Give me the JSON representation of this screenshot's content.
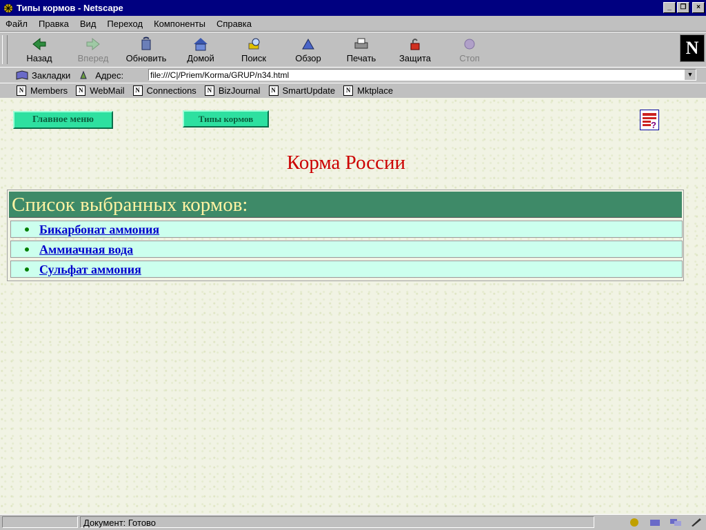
{
  "window": {
    "title": "Типы кормов - Netscape",
    "minimize": "_",
    "maximize": "❐",
    "close": "×"
  },
  "menu": [
    "Файл",
    "Правка",
    "Вид",
    "Переход",
    "Компоненты",
    "Справка"
  ],
  "toolbar": {
    "back": "Назад",
    "forward": "Вперед",
    "reload": "Обновить",
    "home": "Домой",
    "search": "Поиск",
    "guide": "Обзор",
    "print": "Печать",
    "security": "Защита",
    "stop": "Стоп"
  },
  "logo": "N",
  "location": {
    "bookmarks": "Закладки",
    "address_label": "Адрес:",
    "url": "file:///C|/Priem/Korma/GRUP/n34.html"
  },
  "personal": [
    "Members",
    "WebMail",
    "Connections",
    "BizJournal",
    "SmartUpdate",
    "Mktplace"
  ],
  "page": {
    "main_menu": "Главное меню",
    "feed_types": "Типы кормов",
    "title": "Корма России",
    "list_header": "Список выбранных кормов:",
    "items": [
      "Бикарбонат аммония",
      "Аммиачная вода",
      "Сульфат аммония"
    ]
  },
  "status": {
    "text": "Документ: Готово"
  },
  "colors": {
    "titlebar": "#000080",
    "button": "#2ee0a0",
    "heading": "#cc0000",
    "list_header": "#3e8a68",
    "list_header_text": "#fff3a3",
    "row": "#ccffee",
    "link": "#0000cc"
  }
}
